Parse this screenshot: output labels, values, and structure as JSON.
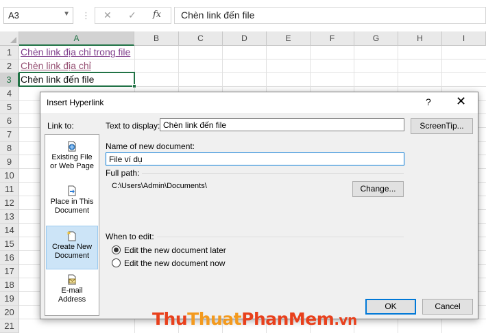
{
  "formula_bar": {
    "name_box": "A3",
    "cancel_icon": "✕",
    "enter_icon": "✓",
    "fx_icon": "fx",
    "content": "Chèn link đến file"
  },
  "sheet": {
    "columns": [
      "A",
      "B",
      "C",
      "D",
      "E",
      "F",
      "G",
      "H",
      "I"
    ],
    "rows": [
      "1",
      "2",
      "3",
      "4",
      "5",
      "6",
      "7",
      "8",
      "9",
      "10",
      "11",
      "12",
      "13",
      "14",
      "15",
      "16",
      "17",
      "18",
      "19",
      "20",
      "21"
    ],
    "cells": {
      "a1": "Chèn link địa chỉ trong file",
      "a2": "Chèn link địa chỉ",
      "a3": "Chèn link đến file"
    },
    "active_cell": "A3"
  },
  "dialog": {
    "title": "Insert Hyperlink",
    "help": "?",
    "close": "✕",
    "link_to": "Link to:",
    "places": [
      {
        "label": "Existing File or Web Page",
        "line1": "Existing File",
        "line2": "or Web Page",
        "icon": "existing-file-icon"
      },
      {
        "label": "Place in This Document",
        "line1": "Place in This",
        "line2": "Document",
        "icon": "place-in-document-icon"
      },
      {
        "label": "Create New Document",
        "line1": "Create New",
        "line2": "Document",
        "icon": "create-new-document-icon",
        "selected": true
      },
      {
        "label": "E-mail Address",
        "line1": "E-mail",
        "line2": "Address",
        "icon": "email-address-icon"
      }
    ],
    "text_to_display_label": "Text to display:",
    "text_to_display_value": "Chèn link đến file",
    "screentip_button": "ScreenTip...",
    "name_label": "Name of new document:",
    "name_value": "File ví dụ",
    "full_path_label": "Full path:",
    "full_path_value": "C:\\Users\\Admin\\Documents\\",
    "change_button": "Change...",
    "when_to_edit_label": "When to edit:",
    "edit_later": "Edit the new document later",
    "edit_now": "Edit the new document now",
    "ok_button": "OK",
    "cancel_button": "Cancel"
  },
  "watermark": {
    "part1": "Thu",
    "part2": "Thuat",
    "part3": "PhanMem",
    "part4": ".vn"
  },
  "colors": {
    "excel_green": "#217346",
    "link_visited": "#954f72",
    "dialog_bg": "#f0f0f0",
    "selected_place": "#cce4f7",
    "default_button_border": "#0078d7"
  }
}
